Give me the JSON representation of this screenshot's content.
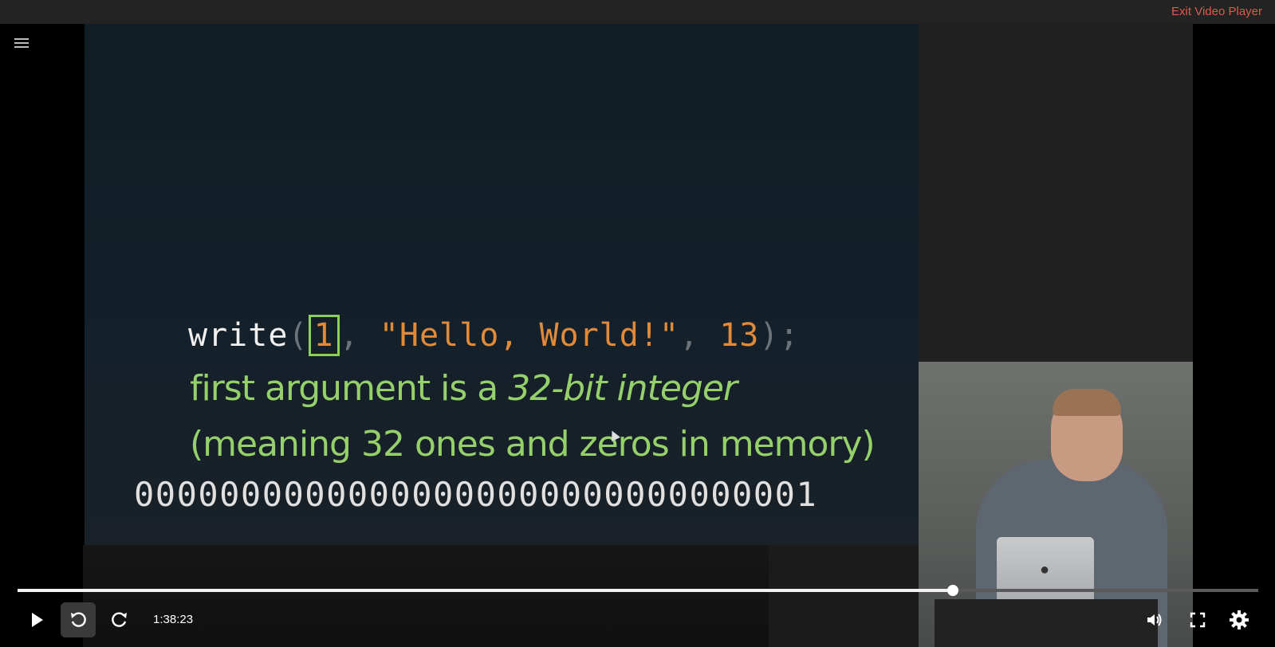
{
  "topbar": {
    "exit_label": "Exit Video Player"
  },
  "slide": {
    "code": {
      "fn": "write",
      "open": "(",
      "arg1": "1",
      "comma1": ", ",
      "str": "\"Hello, World!\"",
      "comma2": ", ",
      "num": "13",
      "close": ");"
    },
    "note_line1_plain": "first argument is a ",
    "note_line1_italic": "32-bit integer",
    "note_line2": "(meaning 32 ones and zeros in memory)",
    "bits": "00000000000000000000000000000001"
  },
  "player": {
    "current_time": "1:38:23",
    "progress_fraction": 0.754,
    "accent": "#ffffff"
  },
  "icons": {
    "menu": "menu-icon",
    "play": "play-icon",
    "rewind": "rewind-icon",
    "forward": "forward-icon",
    "volume": "volume-icon",
    "fullscreen": "fullscreen-icon",
    "settings": "settings-icon"
  }
}
